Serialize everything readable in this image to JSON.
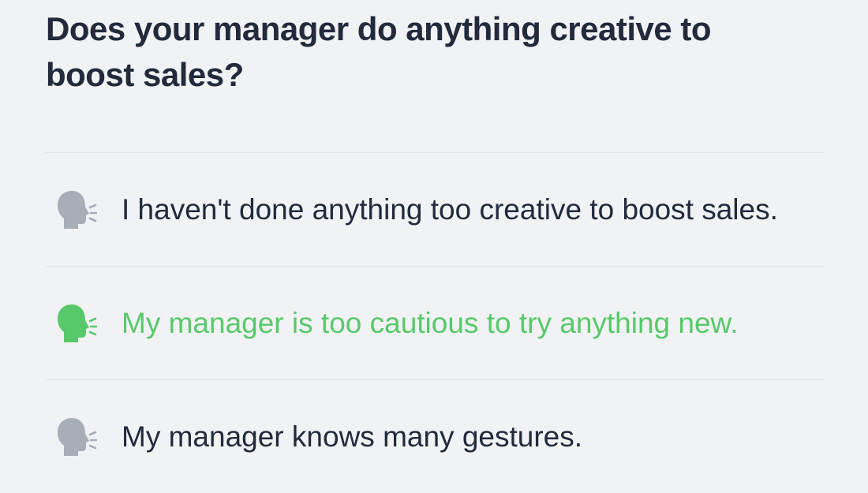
{
  "question": {
    "text": "Does your manager do anything creative to boost sales?"
  },
  "options": [
    {
      "text": "I haven't done anything too creative to boost sales.",
      "selected": false,
      "icon": "speaking-head-icon",
      "color": "#a8adb8"
    },
    {
      "text": "My manager is too cautious to try anything new.",
      "selected": true,
      "icon": "speaking-head-icon",
      "color": "#58c96a"
    },
    {
      "text": "My manager knows many gestures.",
      "selected": false,
      "icon": "speaking-head-icon",
      "color": "#a8adb8"
    }
  ],
  "colors": {
    "text": "#222a3c",
    "selected": "#58c96a",
    "icon_default": "#a8adb8",
    "background": "#f1f2f4",
    "divider": "#dfe2e6"
  }
}
